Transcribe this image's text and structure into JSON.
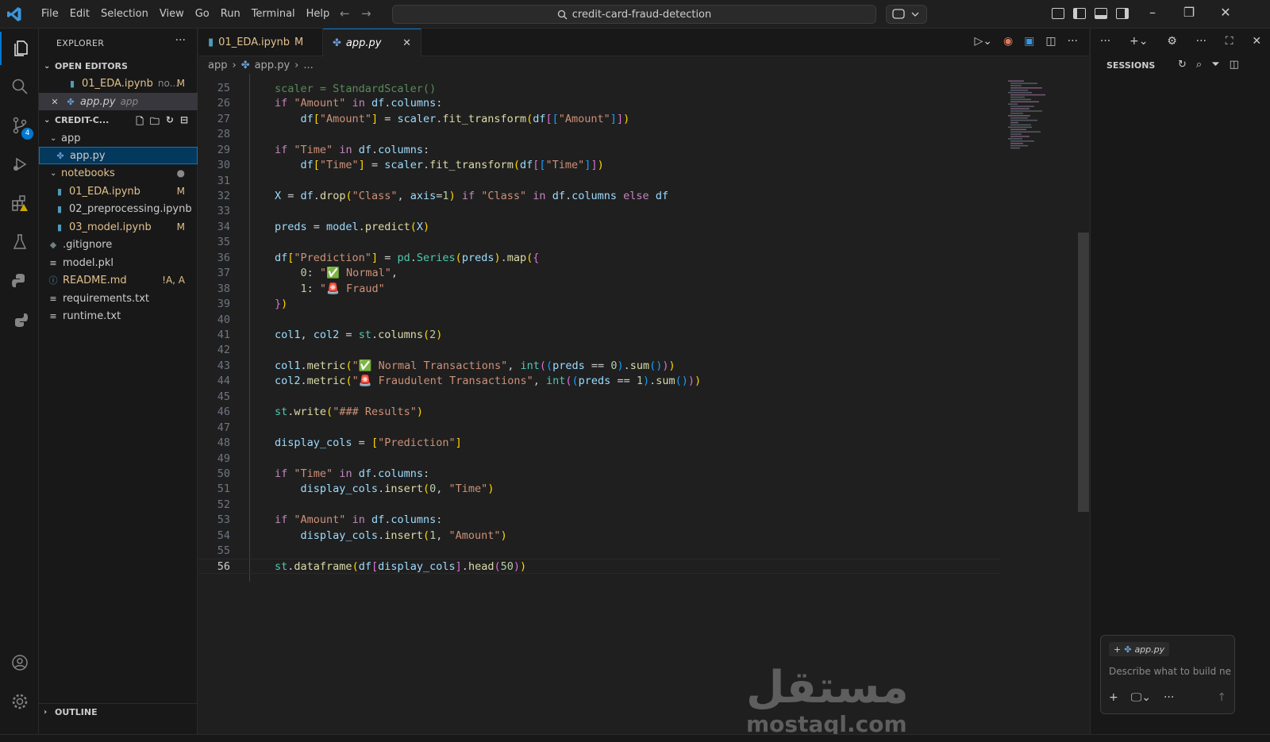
{
  "menu": [
    "File",
    "Edit",
    "Selection",
    "View",
    "Go",
    "Run",
    "Terminal",
    "Help"
  ],
  "command_center": {
    "text": "credit-card-fraud-detection"
  },
  "activity": {
    "scm_badge": "4"
  },
  "explorer": {
    "title": "EXPLORER",
    "open_editors_label": "OPEN EDITORS",
    "open_editors": [
      {
        "name": "01_EDA.ipynb",
        "desc": "no...",
        "status": "M"
      },
      {
        "name": "app.py",
        "desc": "app",
        "status": ""
      }
    ],
    "project_label": "CREDIT-C...",
    "tree": [
      {
        "name": "app",
        "status": ""
      },
      {
        "name": "app.py",
        "status": ""
      },
      {
        "name": "notebooks",
        "status": ""
      },
      {
        "name": "01_EDA.ipynb",
        "status": "M"
      },
      {
        "name": "02_preprocessing.ipynb",
        "status": ""
      },
      {
        "name": "03_model.ipynb",
        "status": "M"
      },
      {
        "name": ".gitignore",
        "status": ""
      },
      {
        "name": "model.pkl",
        "status": ""
      },
      {
        "name": "README.md",
        "status": "!A, A"
      },
      {
        "name": "requirements.txt",
        "status": ""
      },
      {
        "name": "runtime.txt",
        "status": ""
      }
    ],
    "outline_label": "OUTLINE"
  },
  "tabs": [
    {
      "label": "01_EDA.ipynb",
      "status": "M"
    },
    {
      "label": "app.py",
      "status": ""
    }
  ],
  "breadcrumb": {
    "folder": "app",
    "file": "app.py",
    "more": "..."
  },
  "editor": {
    "line_numbers": [
      "25",
      "26",
      "27",
      "28",
      "29",
      "30",
      "31",
      "32",
      "33",
      "34",
      "35",
      "36",
      "37",
      "38",
      "39",
      "40",
      "41",
      "42",
      "43",
      "44",
      "45",
      "46",
      "47",
      "48",
      "49",
      "50",
      "51",
      "52",
      "53",
      "54",
      "55",
      "56"
    ],
    "current_line": "56",
    "partial_top_line": "scaler = StandardScaler()"
  },
  "sessions": {
    "title": "SESSIONS",
    "chip": "app.py",
    "placeholder": "Describe what to build ne"
  },
  "watermark": {
    "arabic": "مستقل",
    "latin": "mostaql.com"
  },
  "colors": {
    "accent": "#0078d4",
    "modified": "#e2c08d",
    "background": "#1f1f1f"
  }
}
